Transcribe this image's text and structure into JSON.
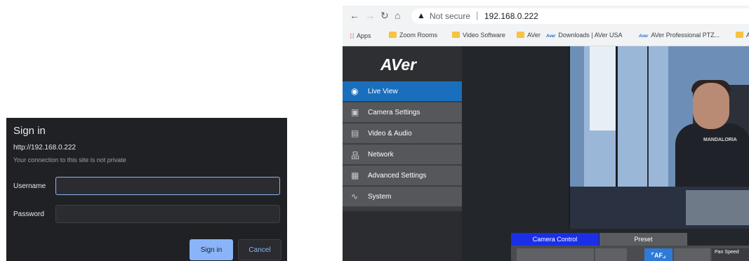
{
  "signin_dialog": {
    "title": "Sign in",
    "url": "http://192.168.0.222",
    "note": "Your connection to this site is not private",
    "username_label": "Username",
    "username_value": "",
    "password_label": "Password",
    "password_value": "",
    "sign_in_button": "Sign in",
    "cancel_button": "Cancel"
  },
  "browser": {
    "security_label": "Not secure",
    "separator": "|",
    "url": "192.168.0.222",
    "bookmarks": [
      "Apps",
      "Zoom Rooms",
      "Video Software",
      "AVer",
      "Downloads | AVer USA",
      "AVer Professional PTZ...",
      "A"
    ]
  },
  "aver_ui": {
    "logo": "AVer",
    "nav": [
      {
        "label": "Live View",
        "icon": "eye-icon",
        "active": true
      },
      {
        "label": "Camera Settings",
        "icon": "image-icon",
        "active": false
      },
      {
        "label": "Video & Audio",
        "icon": "video-audio-icon",
        "active": false
      },
      {
        "label": "Network",
        "icon": "network-icon",
        "active": false
      },
      {
        "label": "Advanced Settings",
        "icon": "settings-doc-icon",
        "active": false
      },
      {
        "label": "System",
        "icon": "pulse-icon",
        "active": false
      }
    ],
    "tabs": [
      "Camera Control",
      "Preset"
    ],
    "pan_speed_label": "Pan Speed",
    "shirt_text": "MANDALORIA"
  },
  "colors": {
    "accent_blue": "#1a6fbd",
    "tab_blue": "#1c2fe8",
    "dialog_bg": "#202124",
    "primary_button": "#8ab4f8"
  }
}
